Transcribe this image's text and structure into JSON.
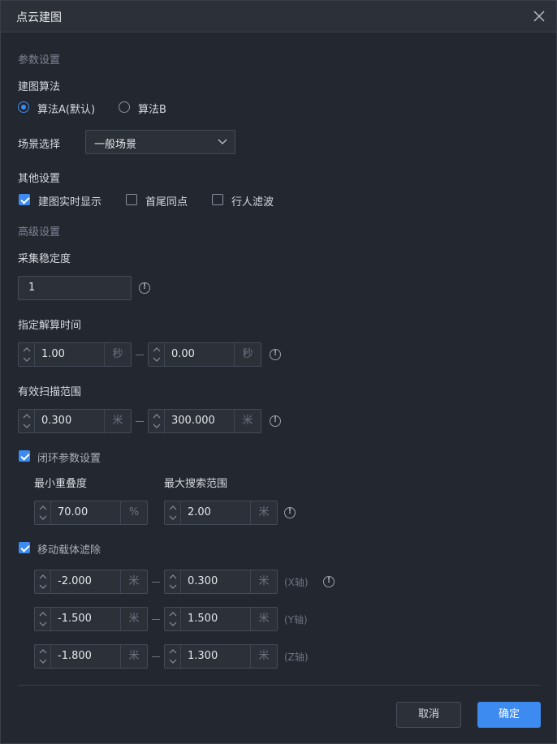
{
  "dialog": {
    "title": "点云建图"
  },
  "params": {
    "section_title": "参数设置",
    "algorithm": {
      "label": "建图算法",
      "options": [
        "算法A(默认)",
        "算法B"
      ],
      "selected": "算法A(默认)"
    },
    "scene": {
      "label": "场景选择",
      "value": "一般场景"
    },
    "other": {
      "label": "其他设置",
      "options": [
        {
          "label": "建图实时显示",
          "checked": true
        },
        {
          "label": "首尾同点",
          "checked": false
        },
        {
          "label": "行人滤波",
          "checked": false
        }
      ]
    }
  },
  "advanced": {
    "section_title": "高级设置",
    "stability": {
      "label": "采集稳定度",
      "value": "1"
    },
    "solve_time": {
      "label": "指定解算时间",
      "from": "1.00",
      "to": "0.00",
      "unit": "秒"
    },
    "scan_range": {
      "label": "有效扫描范围",
      "from": "0.300",
      "to": "300.000",
      "unit": "米"
    },
    "loop_closure": {
      "label": "闭环参数设置",
      "checked": true,
      "min_overlap": {
        "label": "最小重叠度",
        "value": "70.00",
        "unit": "%"
      },
      "max_search": {
        "label": "最大搜索范围",
        "value": "2.00",
        "unit": "米"
      }
    },
    "moving_filter": {
      "label": "移动载体滤除",
      "checked": true,
      "rows": [
        {
          "from": "-2.000",
          "to": "0.300",
          "unit": "米",
          "axis": "(X轴)"
        },
        {
          "from": "-1.500",
          "to": "1.500",
          "unit": "米",
          "axis": "(Y轴)"
        },
        {
          "from": "-1.800",
          "to": "1.300",
          "unit": "米",
          "axis": "(Z轴)"
        }
      ]
    }
  },
  "footer": {
    "cancel": "取消",
    "confirm": "确定"
  },
  "colors": {
    "accent": "#3d8bf0",
    "background": "#232730",
    "input_bg": "#2b3039"
  }
}
